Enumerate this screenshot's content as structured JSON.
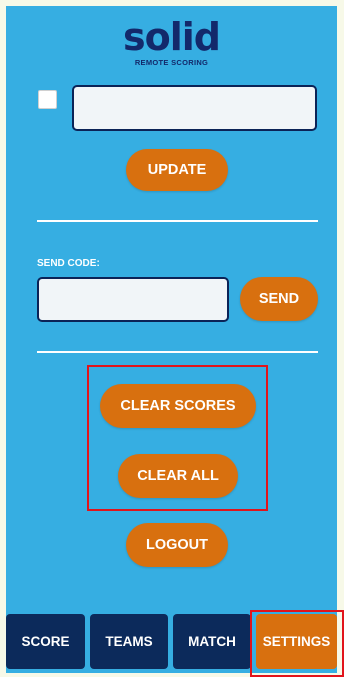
{
  "logo": {
    "word": "solid",
    "subtitle": "REMOTE SCORING"
  },
  "top_form": {
    "checkbox_checked": false,
    "input_value": "",
    "update_label": "UPDATE"
  },
  "send_code": {
    "label": "SEND CODE:",
    "input_value": "",
    "send_label": "SEND"
  },
  "actions": {
    "clear_scores_label": "CLEAR SCORES",
    "clear_all_label": "CLEAR ALL",
    "logout_label": "LOGOUT"
  },
  "tabs": [
    {
      "label": "SCORE",
      "active": false
    },
    {
      "label": "TEAMS",
      "active": false
    },
    {
      "label": "MATCH",
      "active": false
    },
    {
      "label": "SETTINGS",
      "active": true
    }
  ],
  "colors": {
    "background": "#36aee2",
    "accent": "#d8700f",
    "navy": "#0c2a5b",
    "highlight": "#e1141b"
  }
}
